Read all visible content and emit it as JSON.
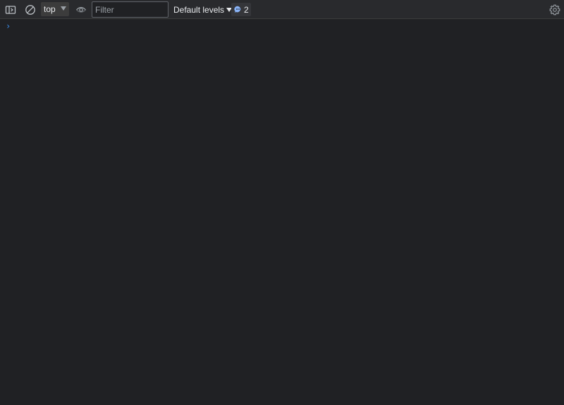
{
  "toolbar": {
    "sidebar_icon": "sidebar-toggle-icon",
    "clear_icon": "clear-console-icon",
    "context": {
      "label": "top",
      "icon": "dropdown-arrow-icon"
    },
    "eye_icon": "live-expression-eye-icon",
    "filter": {
      "placeholder": "Filter",
      "value": ""
    },
    "levels": {
      "label": "Default levels",
      "icon": "dropdown-arrow-icon"
    },
    "issues": {
      "count": "2",
      "icon": "issues-chat-icon",
      "color": "#8ab4f8"
    },
    "settings_icon": "gear-icon"
  },
  "prompt": {
    "symbol": "›",
    "value": ""
  },
  "colors": {
    "background": "#202124",
    "toolbar": "#292a2d",
    "accent": "#3b8eea"
  }
}
